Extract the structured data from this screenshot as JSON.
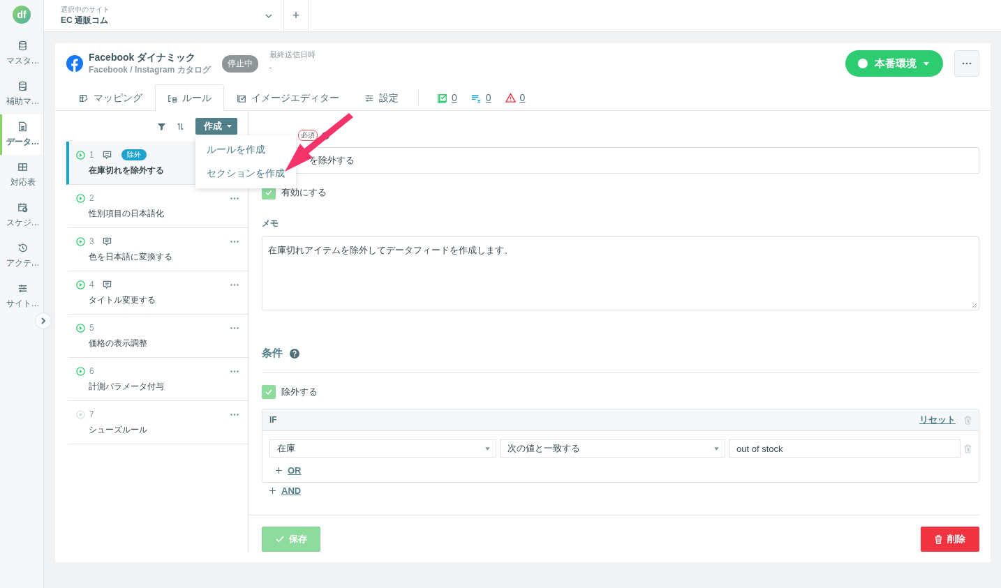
{
  "sidebar": {
    "logo": "df",
    "items": [
      {
        "label": "マスタ…",
        "selected": false
      },
      {
        "label": "補助マ…",
        "selected": false
      },
      {
        "label": "データ…",
        "selected": true
      },
      {
        "label": "対応表",
        "selected": false
      },
      {
        "label": "スケジ…",
        "selected": false
      },
      {
        "label": "アクテ…",
        "selected": false
      },
      {
        "label": "サイト…",
        "selected": false
      }
    ]
  },
  "site_selector": {
    "caption": "選択中のサイト",
    "value": "EC 通販コム",
    "add": "+"
  },
  "feed": {
    "title": "Facebook ダイナミック",
    "subtitle": "Facebook / Instagram カタログ",
    "status": "停止中",
    "last_sent_label": "最終送信日時",
    "last_sent": "-",
    "environment": "本番環境"
  },
  "tabs": [
    {
      "label": "マッピング",
      "selected": false
    },
    {
      "label": "ルール",
      "selected": true
    },
    {
      "label": "イメージエディター",
      "selected": false
    },
    {
      "label": "設定",
      "selected": false
    }
  ],
  "counters": [
    {
      "kind": "ok",
      "value": "0"
    },
    {
      "kind": "excluded",
      "value": "0"
    },
    {
      "kind": "warning",
      "value": "0"
    }
  ],
  "create_button": "作成",
  "create_menu": [
    "ルールを作成",
    "セクションを作成"
  ],
  "rules": [
    {
      "number": "1",
      "title": "在庫切れを除外する",
      "active": true,
      "comment": true,
      "tag": "除外",
      "selected": true
    },
    {
      "number": "2",
      "title": "性別項目の日本語化",
      "active": true,
      "comment": false,
      "selected": false
    },
    {
      "number": "3",
      "title": "色を日本語に変換する",
      "active": true,
      "comment": true,
      "selected": false
    },
    {
      "number": "4",
      "title": "タイトル変更する",
      "active": true,
      "comment": true,
      "selected": false
    },
    {
      "number": "5",
      "title": "価格の表示調整",
      "active": true,
      "comment": false,
      "selected": false
    },
    {
      "number": "6",
      "title": "計測パラメータ付与",
      "active": true,
      "comment": false,
      "selected": false
    },
    {
      "number": "7",
      "title": "シューズルール",
      "active": false,
      "comment": false,
      "selected": false
    }
  ],
  "form": {
    "required": "必須",
    "name_value": "を除外する",
    "enabled_label": "有効にする",
    "enabled": true,
    "memo_label": "メモ",
    "memo": "在庫切れアイテムを除外してデータフィードを作成します。",
    "conditions_title": "条件",
    "exclude_label": "除外する",
    "exclude": true,
    "if_label": "IF",
    "reset": "リセット",
    "condition": {
      "field": "在庫",
      "operator": "次の値と一致する",
      "value": "out of stock"
    },
    "or": "OR",
    "and": "AND",
    "save": "保存",
    "delete": "削除"
  }
}
